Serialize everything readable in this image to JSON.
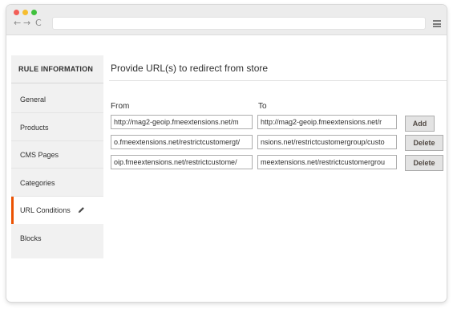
{
  "browser": {
    "back_glyph": "←",
    "forward_glyph": "→",
    "reload_glyph": "C",
    "address": ""
  },
  "sidebar": {
    "title": "RULE INFORMATION",
    "items": [
      {
        "label": "General"
      },
      {
        "label": "Products"
      },
      {
        "label": "CMS Pages"
      },
      {
        "label": "Categories"
      },
      {
        "label": "URL Conditions",
        "active": true
      },
      {
        "label": "Blocks"
      }
    ],
    "active_accent": "#eb5202"
  },
  "main": {
    "title": "Provide URL(s) to redirect from store",
    "from_label": "From",
    "to_label": "To",
    "rows": [
      {
        "from": "http://mag2-geoip.fmeextensions.net/m",
        "to": "http://mag2-geoip.fmeextensions.net/r",
        "action": "Add"
      },
      {
        "from": "o.fmeextensions.net/restrictcustomergt/",
        "to": "nsions.net/restrictcustomergroup/custo",
        "action": "Delete"
      },
      {
        "from": "oip.fmeextensions.net/restrictcustome/",
        "to": "meextensions.net/restrictcustomergrou",
        "action": "Delete"
      }
    ]
  },
  "icons": {
    "menu": "hamburger-icon",
    "pencil": "pencil-icon"
  }
}
